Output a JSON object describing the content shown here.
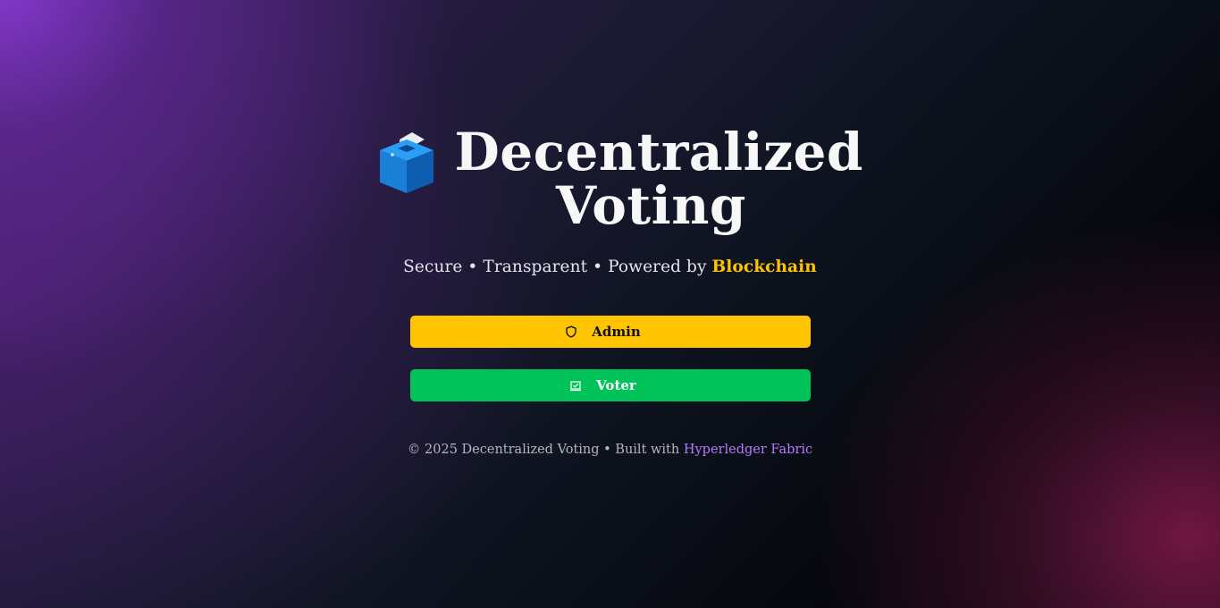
{
  "header": {
    "icon": "ballot-box-icon",
    "title": "Decentralized Voting"
  },
  "subtitle": {
    "prefix": "Secure • Transparent • Powered by ",
    "accent": "Blockchain"
  },
  "buttons": {
    "admin": {
      "label": "Admin",
      "icon": "shield-icon"
    },
    "voter": {
      "label": "Voter",
      "icon": "vote-icon"
    }
  },
  "footer": {
    "text": "© 2025 Decentralized Voting • Built with ",
    "link": "Hyperledger Fabric"
  },
  "colors": {
    "accent_yellow": "#ffc400",
    "accent_green": "#00c45a",
    "link_purple": "#b57cff"
  }
}
